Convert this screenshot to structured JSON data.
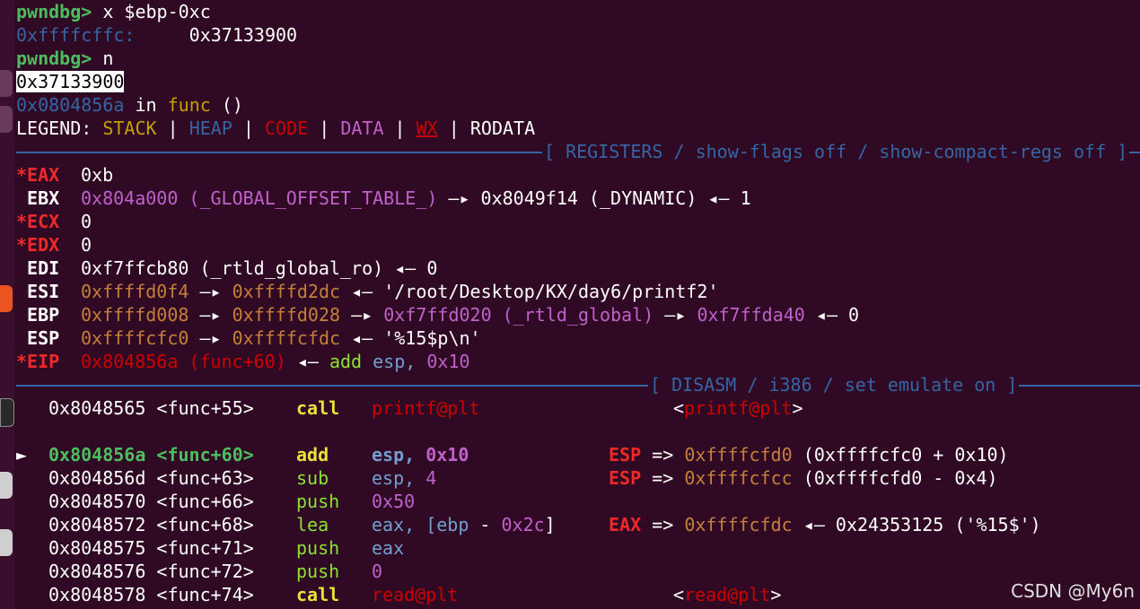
{
  "prompt": "pwndbg>",
  "cmd1": "x $ebp-0xc",
  "mem_addr": "0xffffcffc:",
  "mem_val": "0x37133900",
  "cmd2": "n",
  "out_val": "0x37133900",
  "loc_addr": "0x0804856a",
  "loc_in": "in",
  "loc_func": "func",
  "loc_parens": "()",
  "legend": {
    "label": "LEGEND:",
    "stack": "STACK",
    "heap": "HEAP",
    "code": "CODE",
    "data": "DATA",
    "wx": "WX",
    "rodata": "RODATA",
    "sep": "|"
  },
  "registers_banner": "[ REGISTERS / show-flags off / show-compact-regs off ]",
  "disasm_banner": "[ DISASM / i386 / set emulate on ]",
  "registers": [
    {
      "mark": "*",
      "name": "EAX",
      "v1": "0xb"
    },
    {
      "mark": " ",
      "name": "EBX",
      "v1": "0x804a000 (_GLOBAL_OFFSET_TABLE_)",
      "a1": "—▸",
      "v2": "0x8049f14 (_DYNAMIC)",
      "a2": "◂—",
      "v3": "1"
    },
    {
      "mark": "*",
      "name": "ECX",
      "v1": "0"
    },
    {
      "mark": "*",
      "name": "EDX",
      "v1": "0"
    },
    {
      "mark": " ",
      "name": "EDI",
      "v1": "0xf7ffcb80 (_rtld_global_ro)",
      "a1": "◂—",
      "v2": "0"
    },
    {
      "mark": " ",
      "name": "ESI",
      "v1": "0xffffd0f4",
      "a1": "—▸",
      "v2": "0xffffd2dc",
      "a2": "◂—",
      "v3": "'/root/Desktop/KX/day6/printf2'"
    },
    {
      "mark": " ",
      "name": "EBP",
      "v1": "0xffffd008",
      "a1": "—▸",
      "v2": "0xffffd028",
      "a2": "—▸",
      "v3": "0xf7ffd020 (_rtld_global)",
      "a3": "—▸",
      "v4": "0xf7ffda40",
      "a4": "◂—",
      "v5": "0"
    },
    {
      "mark": " ",
      "name": "ESP",
      "v1": "0xffffcfc0",
      "a1": "—▸",
      "v2": "0xffffcfdc",
      "a2": "◂—",
      "v3": "'%15$p\\n'"
    },
    {
      "mark": "*",
      "name": "EIP",
      "v1": "0x804856a (func+60)",
      "a1": "◂—",
      "v2": "add",
      "v3": "esp,",
      "v4": "0x10"
    }
  ],
  "disasm": [
    {
      "cur": "",
      "addr": "0x8048565",
      "sym": "<func+55>",
      "mn": "call",
      "op": "printf@plt",
      "cm_a": "<",
      "cm_b": "printf@plt",
      "cm_c": ">"
    },
    {
      "cur": "►",
      "addr": "0x804856a",
      "sym": "<func+60>",
      "mn": "add",
      "op1": "esp,",
      "op2": "0x10",
      "cm_r": "ESP",
      "cm_eq": "=>",
      "cm_v": "0xffffcfd0",
      "cm_x": "(0xffffcfc0 + 0x10)"
    },
    {
      "cur": "",
      "addr": "0x804856d",
      "sym": "<func+63>",
      "mn": "sub",
      "op1": "esp,",
      "op2": "4",
      "cm_r": "ESP",
      "cm_eq": "=>",
      "cm_v": "0xffffcfcc",
      "cm_x": "(0xffffcfd0 - 0x4)"
    },
    {
      "cur": "",
      "addr": "0x8048570",
      "sym": "<func+66>",
      "mn": "push",
      "op1": "0x50"
    },
    {
      "cur": "",
      "addr": "0x8048572",
      "sym": "<func+68>",
      "mn": "lea",
      "op1": "eax, [",
      "op2": "ebp",
      "op3": " - ",
      "op4": "0x2c",
      "op5": "]",
      "cm_r": "EAX",
      "cm_eq": "=>",
      "cm_v": "0xffffcfdc",
      "cm_arrow": "◂—",
      "cm_x": "0x24353125 ('%15$')"
    },
    {
      "cur": "",
      "addr": "0x8048575",
      "sym": "<func+71>",
      "mn": "push",
      "op1": "eax"
    },
    {
      "cur": "",
      "addr": "0x8048576",
      "sym": "<func+72>",
      "mn": "push",
      "op1": "0"
    },
    {
      "cur": "",
      "addr": "0x8048578",
      "sym": "<func+74>",
      "mn": "call",
      "op": "read@plt",
      "cm_a": "<",
      "cm_b": "read@plt",
      "cm_c": ">"
    }
  ],
  "watermark": "CSDN @My6n"
}
